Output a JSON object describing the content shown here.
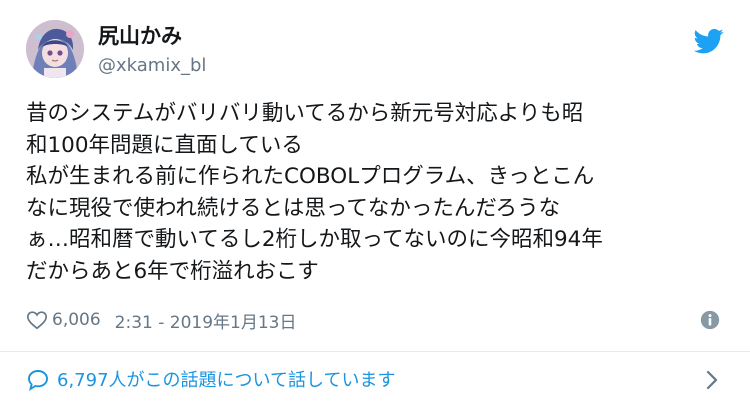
{
  "tweet": {
    "author_name": "尻山かみ",
    "author_handle": "@xkamix_bl",
    "text_lines": [
      "昔のシステムがバリバリ動いてるから新元号対応よりも昭",
      "和100年問題に直面している",
      "私が生まれる前に作られたCOBOLプログラム、きっとこん",
      "なに現役で使われ続けるとは思ってなかったんだろうな",
      "ぁ…昭和暦で動いてるし2桁しか取ってないのに今昭和94年",
      "だからあと6年で桁溢れおこす"
    ],
    "likes": "6,006",
    "timestamp": "2:31 - 2019年1月13日"
  },
  "footer": {
    "conversation_text": "6,797人がこの話題について話しています"
  },
  "icons": {
    "brand": "twitter-bird-icon",
    "like": "heart-icon",
    "info": "info-icon",
    "conversation": "speech-bubble-icon",
    "more": "chevron-right-icon"
  },
  "colors": {
    "twitter_blue": "#1da1f2",
    "link_blue": "#1b95e0",
    "text": "#14171a",
    "muted": "#657786"
  }
}
